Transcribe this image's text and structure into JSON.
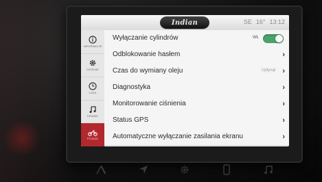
{
  "header": {
    "brand": "Indian",
    "status_left": "SE",
    "temperature": "16°",
    "time": "13:12"
  },
  "sidebar": {
    "items": [
      {
        "label": "INFORMACJE",
        "icon": "info-icon"
      },
      {
        "label": "OGÓLNE",
        "icon": "gear-icon"
      },
      {
        "label": "CZAS",
        "icon": "clock-icon"
      },
      {
        "label": "DŹWIĘK",
        "icon": "music-note-icon"
      },
      {
        "label": "POJAZD",
        "icon": "motorcycle-icon",
        "active": true
      }
    ]
  },
  "settings": {
    "rows": [
      {
        "label": "Wyłączanie cylindrów",
        "toggle_label": "WŁ",
        "toggle_on": true
      },
      {
        "label": "Odblokowanie hasłem"
      },
      {
        "label": "Czas do wymiany oleju",
        "value": "Upłynął"
      },
      {
        "label": "Diagnostyka"
      },
      {
        "label": "Monitorowanie ciśnienia"
      },
      {
        "label": "Status GPS"
      },
      {
        "label": "Automatyczne wyłączanie zasilania ekranu"
      }
    ]
  },
  "colors": {
    "accent_red": "#b3282d",
    "toggle_green": "#4aa36a"
  },
  "hardware_buttons": [
    "home-icon",
    "navigation-arrow-icon",
    "settings-icon",
    "phone-icon",
    "music-note-icon"
  ]
}
